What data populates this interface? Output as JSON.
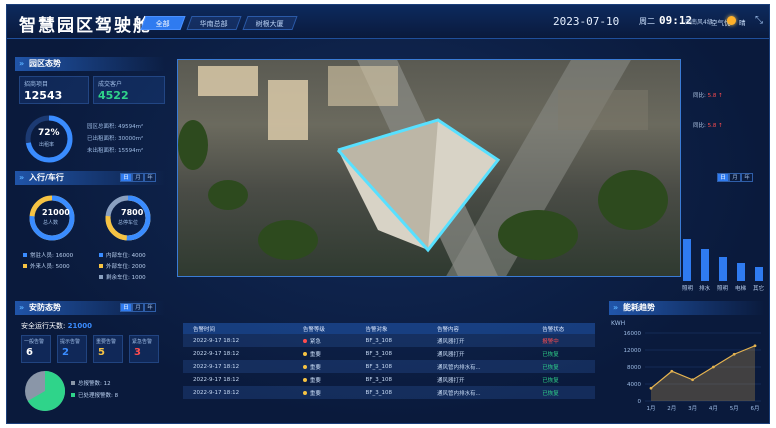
{
  "header": {
    "title": "智慧园区驾驶舱",
    "tabs": [
      {
        "label": "全部",
        "active": true
      },
      {
        "label": "华南总部",
        "active": false
      },
      {
        "label": "树根大厦",
        "active": false
      }
    ],
    "date": "2023-07-10",
    "weekday": "周二",
    "time": "09:12",
    "wind": "西南风4级",
    "air": "空气优",
    "weather": "晴"
  },
  "park": {
    "title": "园区态势",
    "stats": [
      {
        "label": "招商项目",
        "value": "12543"
      },
      {
        "label": "成交客户",
        "value": "4522"
      }
    ],
    "rate": {
      "value": "72%",
      "label": "出租率"
    },
    "areas": [
      {
        "label": "园区总面积:",
        "value": "49594m²"
      },
      {
        "label": "已出租面积:",
        "value": "30000m²"
      },
      {
        "label": "未出租面积:",
        "value": "15594m²"
      }
    ]
  },
  "traffic": {
    "title": "入行/车行",
    "segments": [
      "日",
      "月",
      "年"
    ],
    "people": {
      "value": "21000",
      "label": "总人数"
    },
    "cars": {
      "value": "7800",
      "label": "总停车位"
    },
    "people_legend": [
      {
        "label": "常驻人员: 16000",
        "color": "#3a8cff"
      },
      {
        "label": "外来人员: 5000",
        "color": "#f6c343"
      }
    ],
    "car_legend": [
      {
        "label": "内部车位: 4000",
        "color": "#3a8cff"
      },
      {
        "label": "外部车位: 2000",
        "color": "#f6c343"
      },
      {
        "label": "剩余车位: 1000",
        "color": "#8aa0c0"
      }
    ]
  },
  "security": {
    "title": "安防态势",
    "segments": [
      "日",
      "月",
      "年"
    ],
    "days_label": "安全运行天数:",
    "days_value": "21000",
    "alarms": [
      {
        "label": "一般告警",
        "value": "6",
        "color": "#ffffff"
      },
      {
        "label": "提示告警",
        "value": "2",
        "color": "#3a8cff"
      },
      {
        "label": "重要告警",
        "value": "5",
        "color": "#f6c343"
      },
      {
        "label": "紧急告警",
        "value": "3",
        "color": "#ff4d4f"
      }
    ],
    "total_label": "总报警数:",
    "total_value": "12",
    "handled_label": "已处理报警数:",
    "handled_value": "8",
    "handled_fraction": 0.67
  },
  "alarm_table": {
    "columns": [
      "告警时间",
      "告警等级",
      "告警对象",
      "告警内容",
      "告警状态"
    ],
    "rows": [
      {
        "time": "2022-9-17 18:12",
        "level": "紧急",
        "level_color": "#ff4d4f",
        "object": "BF_3_108",
        "content": "通风器打开",
        "status": "报警中",
        "status_class": "s-red"
      },
      {
        "time": "2022-9-17 18:12",
        "level": "重要",
        "level_color": "#f6c343",
        "object": "BF_3_108",
        "content": "通风器打开",
        "status": "已恢复",
        "status_class": "s-green"
      },
      {
        "time": "2022-9-17 18:12",
        "level": "重要",
        "level_color": "#f6c343",
        "object": "BF_3_108",
        "content": "通风管内排水有...",
        "status": "已恢复",
        "status_class": "s-green"
      },
      {
        "time": "2022-9-17 18:12",
        "level": "重要",
        "level_color": "#f6c343",
        "object": "BF_3_108",
        "content": "通风器打开",
        "status": "已恢复",
        "status_class": "s-green"
      },
      {
        "time": "2022-9-17 18:12",
        "level": "重要",
        "level_color": "#f6c343",
        "object": "BF_3_108",
        "content": "通风管内排水有...",
        "status": "已恢复",
        "status_class": "s-green"
      }
    ]
  },
  "right_panel": {
    "compare": [
      {
        "label": "同比:",
        "value": "5.8 ↑"
      },
      {
        "label": "同比:",
        "value": "5.8 ↑"
      }
    ],
    "segments": [
      "日",
      "月",
      "年"
    ],
    "bar_categories": [
      "照明",
      "排水",
      "照明",
      "电梯",
      "其它"
    ]
  },
  "chart_data": {
    "type": "area",
    "title": "能耗趋势",
    "ylabel": "KWH",
    "categories": [
      "1月",
      "2月",
      "3月",
      "4月",
      "5月",
      "6月"
    ],
    "values": [
      3000,
      7000,
      5000,
      8000,
      11000,
      13000
    ],
    "ylim": [
      0,
      16000
    ],
    "yticks": [
      "16000",
      "12000",
      "8000",
      "4000",
      "0"
    ]
  }
}
